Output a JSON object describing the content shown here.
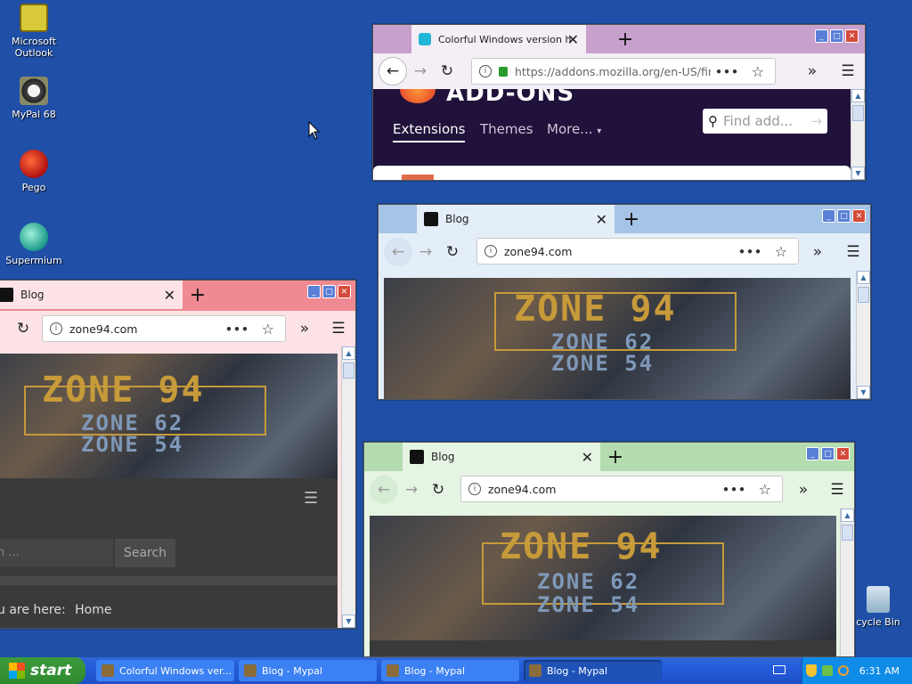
{
  "desktop": {
    "icons": [
      {
        "label": "Microsoft Outlook",
        "icon": "outlook-icon"
      },
      {
        "label": "MyPal 68",
        "icon": "mypal-icon"
      },
      {
        "label": "Pego",
        "icon": "pego-icon"
      },
      {
        "label": "Supermium",
        "icon": "supermium-icon"
      },
      {
        "label": "cycle Bin",
        "icon": "recycle-bin-icon"
      }
    ]
  },
  "windows": {
    "addons": {
      "tab_title": "Colorful Windows version history",
      "url": "https://addons.mozilla.org/en-US/firefo",
      "url_domain": "mozilla.org",
      "brand": "ADD-ONS",
      "nav": [
        "Extensions",
        "Themes",
        "More..."
      ],
      "search_placeholder": "Find add..."
    },
    "blog_blue": {
      "tab_title": "Blog",
      "url": "zone94.com"
    },
    "blog_red": {
      "tab_title": "Blog",
      "url": "zone94.com",
      "search_placeholder": "h ...",
      "search_button": "Search",
      "breadcrumb_prefix": "u are here:",
      "breadcrumb_home": "Home"
    },
    "blog_green": {
      "tab_title": "Blog",
      "url": "zone94.com"
    }
  },
  "zone_banner": {
    "line1": "ZONE 94",
    "line2": "ZONE 62",
    "line3": "ZONE 54"
  },
  "taskbar": {
    "start": "start",
    "buttons": [
      "Colorful Windows ver...",
      "Blog - Mypal",
      "Blog - Mypal",
      "Blog - Mypal"
    ],
    "clock": "6:31 AM"
  },
  "colors": {
    "desktop": "#1f4fa6",
    "addons_tabbar": "#c8a0cc",
    "blue_tabbar": "#a6c4e6",
    "red_tabbar": "#f08a92",
    "green_tabbar": "#b4dcb0",
    "addons_header": "#20123a"
  }
}
